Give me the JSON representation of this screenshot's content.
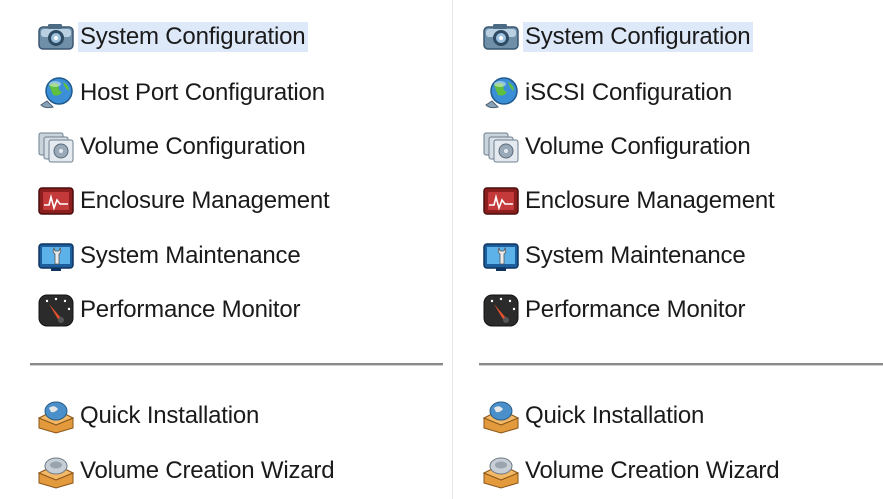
{
  "left_panel": {
    "items": [
      {
        "label": "System Configuration",
        "icon": "camera-icon"
      },
      {
        "label": "Host Port Configuration",
        "icon": "globe-icon"
      },
      {
        "label": "Volume Configuration",
        "icon": "disks-icon"
      },
      {
        "label": "Enclosure Management",
        "icon": "monitor-graph-icon"
      },
      {
        "label": "System Maintenance",
        "icon": "wrench-monitor-icon"
      },
      {
        "label": "Performance Monitor",
        "icon": "gauge-icon"
      },
      {
        "label": "Quick Installation",
        "icon": "box-globe-icon"
      },
      {
        "label": "Volume Creation Wizard",
        "icon": "box-disk-icon"
      }
    ],
    "selected": "System Configuration"
  },
  "right_panel": {
    "items": [
      {
        "label": "System Configuration",
        "icon": "camera-icon"
      },
      {
        "label": "iSCSI Configuration",
        "icon": "globe-icon"
      },
      {
        "label": "Volume Configuration",
        "icon": "disks-icon"
      },
      {
        "label": "Enclosure Management",
        "icon": "monitor-graph-icon"
      },
      {
        "label": "System Maintenance",
        "icon": "wrench-monitor-icon"
      },
      {
        "label": "Performance Monitor",
        "icon": "gauge-icon"
      },
      {
        "label": "Quick Installation",
        "icon": "box-globe-icon"
      },
      {
        "label": "Volume Creation Wizard",
        "icon": "box-disk-icon"
      }
    ],
    "selected": "System Configuration"
  },
  "colors": {
    "selection_bg": "#dde8f8",
    "text": "#1a1a1a",
    "separator": "#8a8a8a"
  }
}
